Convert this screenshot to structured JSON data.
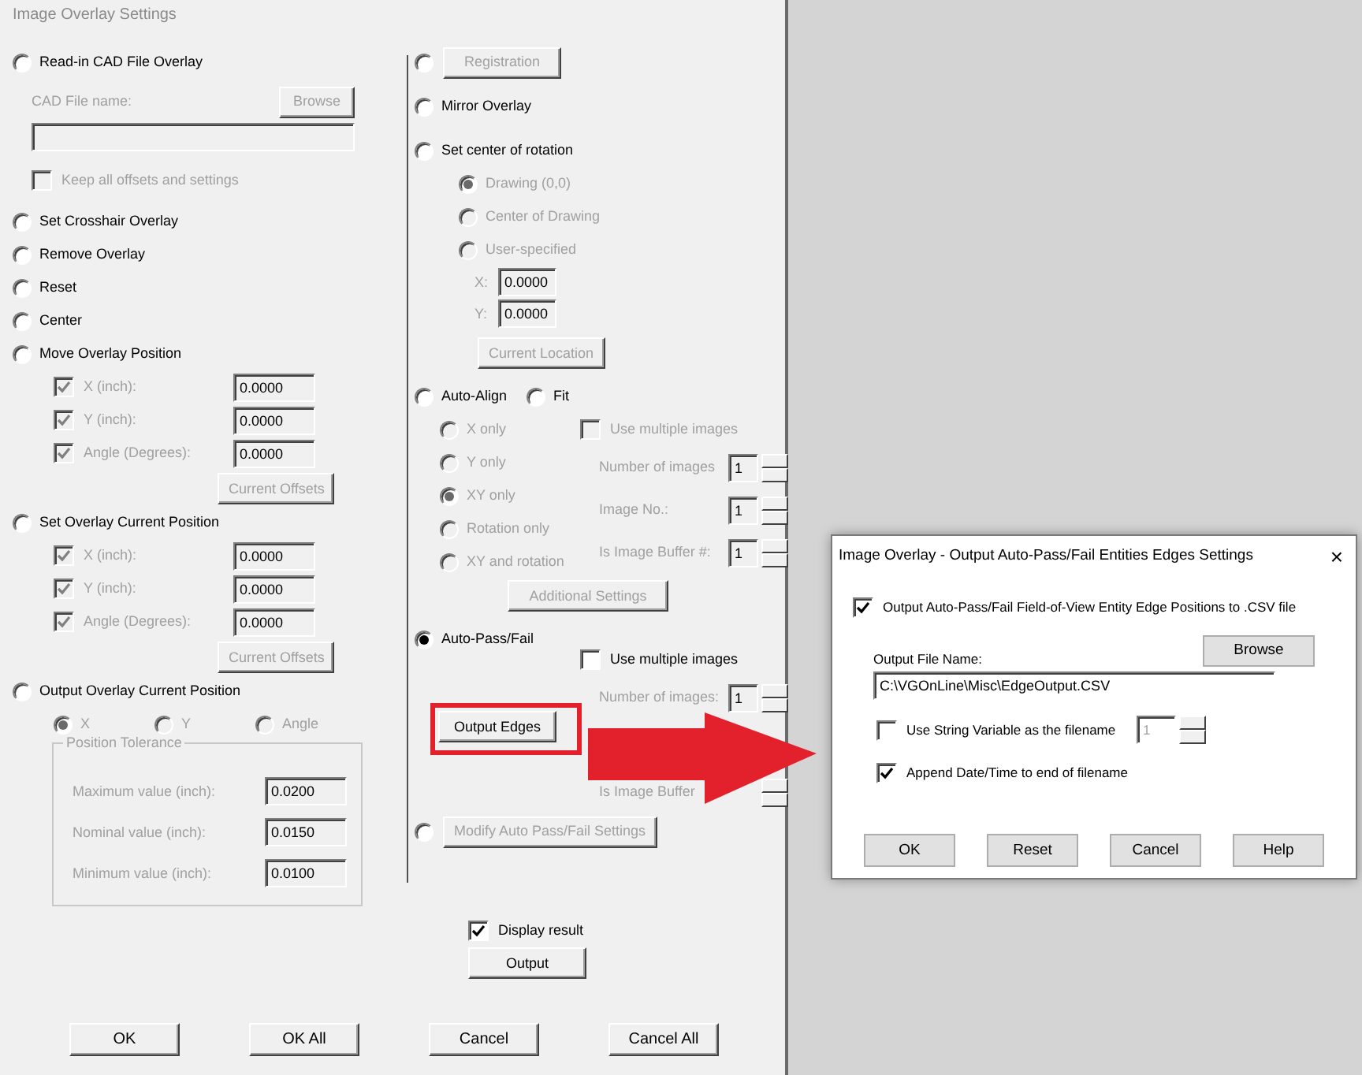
{
  "window": {
    "title": "Image Overlay Settings"
  },
  "left": [
    {
      "kind": "radio",
      "label": "Read-in CAD File Overlay",
      "selected": false,
      "disabled": false,
      "children": [
        {
          "kind": "file",
          "label": "CAD File name:",
          "button": "Browse",
          "disabled": true
        },
        {
          "kind": "check",
          "label": "Keep all offsets and settings",
          "checked": false,
          "disabled": true
        }
      ]
    },
    {
      "kind": "radio",
      "label": "Set Crosshair Overlay",
      "selected": false,
      "disabled": false
    },
    {
      "kind": "radio",
      "label": "Remove Overlay",
      "selected": false,
      "disabled": false
    },
    {
      "kind": "radio",
      "label": "Reset",
      "selected": false,
      "disabled": false
    },
    {
      "kind": "radio",
      "label": "Center",
      "selected": false,
      "disabled": false
    },
    {
      "kind": "radio",
      "label": "Move Overlay Position",
      "selected": false,
      "disabled": false,
      "children": [
        {
          "kind": "checkfield",
          "label": "X (inch):",
          "checked": true,
          "value": "0.0000",
          "disabled": true
        },
        {
          "kind": "checkfield",
          "label": "Y (inch):",
          "checked": true,
          "value": "0.0000",
          "disabled": true
        },
        {
          "kind": "checkfield",
          "label": "Angle (Degrees):",
          "checked": true,
          "value": "0.0000",
          "disabled": true
        },
        {
          "kind": "button",
          "label": "Current Offsets",
          "disabled": true
        }
      ]
    },
    {
      "kind": "radio",
      "label": "Set Overlay Current Position",
      "selected": false,
      "disabled": false,
      "children": [
        {
          "kind": "checkfield",
          "label": "X (inch):",
          "checked": true,
          "value": "0.0000",
          "disabled": true
        },
        {
          "kind": "checkfield",
          "label": "Y (inch):",
          "checked": true,
          "value": "0.0000",
          "disabled": true
        },
        {
          "kind": "checkfield",
          "label": "Angle (Degrees):",
          "checked": true,
          "value": "0.0000",
          "disabled": true
        },
        {
          "kind": "button",
          "label": "Current Offsets",
          "disabled": true
        }
      ]
    },
    {
      "kind": "radio",
      "label": "Output Overlay Current Position",
      "selected": false,
      "disabled": false,
      "children": [
        {
          "kind": "radios",
          "items": [
            {
              "label": "X",
              "selected": true,
              "disabled": true
            },
            {
              "label": "Y",
              "selected": false,
              "disabled": true
            },
            {
              "label": "Angle",
              "selected": false,
              "disabled": true
            }
          ]
        },
        {
          "kind": "group",
          "label": "Position Tolerance",
          "disabled": true,
          "fields": [
            {
              "label": "Maximum value (inch):",
              "value": "0.0200"
            },
            {
              "label": "Nominal value (inch):",
              "value": "0.0150"
            },
            {
              "label": "Minimum value (inch):",
              "value": "0.0100"
            }
          ]
        }
      ]
    }
  ],
  "right": [
    {
      "kind": "radiobutton",
      "selected": false,
      "disabled": false,
      "button": "Registration",
      "button_disabled": true
    },
    {
      "kind": "radio",
      "label": "Mirror Overlay",
      "selected": false,
      "disabled": false
    },
    {
      "kind": "radio",
      "label": "Set center of rotation",
      "selected": false,
      "disabled": false,
      "children": [
        {
          "kind": "radio",
          "label": "Drawing (0,0)",
          "selected": true,
          "disabled": true
        },
        {
          "kind": "radio",
          "label": "Center of Drawing",
          "selected": false,
          "disabled": true
        },
        {
          "kind": "radio",
          "label": "User-specified",
          "selected": false,
          "disabled": true
        },
        {
          "kind": "field",
          "label": "X:",
          "value": "0.0000",
          "disabled": true
        },
        {
          "kind": "field",
          "label": "Y:",
          "value": "0.0000",
          "disabled": true
        },
        {
          "kind": "button",
          "label": "Current Location",
          "disabled": true
        }
      ]
    },
    {
      "kind": "pair",
      "items": [
        {
          "label": "Auto-Align",
          "selected": false,
          "disabled": false
        },
        {
          "label": "Fit",
          "selected": false,
          "disabled": false
        }
      ],
      "children": [
        {
          "kind": "grid",
          "left": [
            {
              "kind": "radio",
              "label": "X only",
              "selected": false,
              "disabled": true
            },
            {
              "kind": "radio",
              "label": "Y only",
              "selected": false,
              "disabled": true
            },
            {
              "kind": "radio",
              "label": "XY only",
              "selected": true,
              "disabled": true
            },
            {
              "kind": "radio",
              "label": "Rotation only",
              "selected": false,
              "disabled": true
            },
            {
              "kind": "radio",
              "label": "XY and rotation",
              "selected": false,
              "disabled": true
            }
          ],
          "right": [
            {
              "kind": "check",
              "label": "Use multiple images",
              "checked": false,
              "disabled": true
            },
            {
              "kind": "spin",
              "label": "Number of images",
              "value": "1",
              "disabled": true
            },
            {
              "kind": "spin",
              "label": "Image No.:",
              "value": "1",
              "disabled": true
            },
            {
              "kind": "spin",
              "label": "Is Image Buffer #:",
              "value": "1",
              "disabled": true
            }
          ]
        },
        {
          "kind": "button",
          "label": "Additional Settings",
          "disabled": true
        }
      ]
    },
    {
      "kind": "radio",
      "label": "Auto-Pass/Fail",
      "selected": true,
      "disabled": false,
      "children": [
        {
          "kind": "split",
          "left": [
            {
              "kind": "button",
              "label": "Output Edges",
              "disabled": false,
              "highlighted": true
            }
          ],
          "right": [
            {
              "kind": "check",
              "label": "Use multiple images",
              "checked": false,
              "disabled": false
            },
            {
              "kind": "spin",
              "label": "Number of images:",
              "value": "1",
              "disabled": true
            },
            {
              "kind": "spin",
              "label": "Is Image Buffer",
              "disabled": true
            }
          ]
        }
      ]
    },
    {
      "kind": "radiobutton",
      "selected": false,
      "disabled": false,
      "button": "Modify Auto Pass/Fail Settings",
      "button_disabled": true
    },
    {
      "kind": "check",
      "label": "Display result",
      "checked": true,
      "disabled": false
    },
    {
      "kind": "button",
      "label": "Output",
      "disabled": false
    }
  ],
  "footer": [
    "OK",
    "OK All",
    "Cancel",
    "Cancel All"
  ],
  "popup": {
    "title": "Image Overlay - Output Auto-Pass/Fail Entities Edges Settings",
    "close": "×",
    "output_check": {
      "label": "Output Auto-Pass/Fail Field-of-View Entity Edge Positions to .CSV file",
      "checked": true
    },
    "file_label": "Output File Name:",
    "browse": "Browse",
    "file_value": "C:\\VGOnLine\\Misc\\EdgeOutput.CSV",
    "string_check": {
      "label": "Use String Variable as the filename",
      "checked": false
    },
    "string_spin": {
      "value": "1",
      "disabled": true
    },
    "date_check": {
      "label": "Append Date/Time to end of filename",
      "checked": true
    },
    "buttons": [
      "OK",
      "Reset",
      "Cancel",
      "Help"
    ]
  }
}
